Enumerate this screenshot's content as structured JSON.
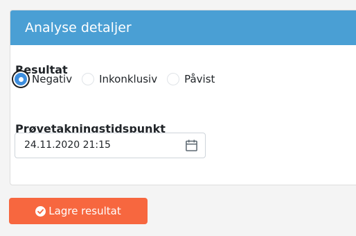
{
  "panel": {
    "title": "Analyse detaljer"
  },
  "result": {
    "label": "Resultat",
    "options": [
      {
        "label": "Negativ",
        "checked": true
      },
      {
        "label": "Inkonklusiv",
        "checked": false
      },
      {
        "label": "Påvist",
        "checked": false
      }
    ]
  },
  "sampling": {
    "label": "Prøvetakningstidspunkt",
    "value": "24.11.2020 21:15",
    "icon": "calendar-icon"
  },
  "save_button": {
    "label": "Lagre resultat",
    "icon": "check-circle-icon",
    "color": "#f7673f"
  },
  "colors": {
    "header": "#4a9fd4",
    "radio_checked": "#3e8edd"
  }
}
